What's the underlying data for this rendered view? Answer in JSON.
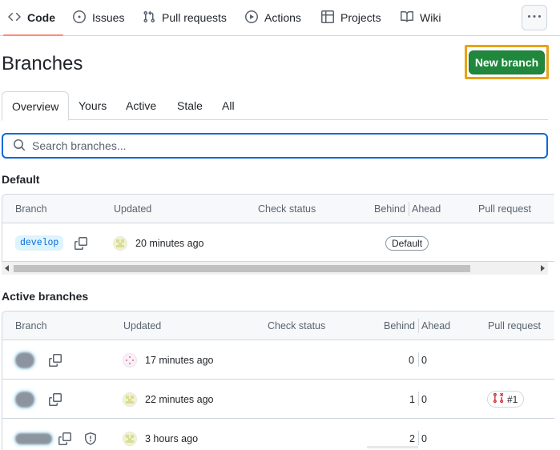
{
  "nav": {
    "tabs": [
      {
        "label": "Code",
        "icon": "code-icon",
        "active": true
      },
      {
        "label": "Issues",
        "icon": "issue-opened-icon"
      },
      {
        "label": "Pull requests",
        "icon": "git-pull-request-icon"
      },
      {
        "label": "Actions",
        "icon": "play-icon"
      },
      {
        "label": "Projects",
        "icon": "table-icon"
      },
      {
        "label": "Wiki",
        "icon": "book-icon"
      }
    ],
    "more_icon": "kebab-horizontal-icon"
  },
  "page": {
    "title": "Branches",
    "new_branch_label": "New branch"
  },
  "subtabs": [
    "Overview",
    "Yours",
    "Active",
    "Stale",
    "All"
  ],
  "search": {
    "placeholder": "Search branches..."
  },
  "default_section": {
    "title": "Default",
    "headers": [
      "Branch",
      "Updated",
      "Check status",
      "Behind",
      "Ahead",
      "Pull request"
    ],
    "rows": [
      {
        "branch": "develop",
        "updated": "20 minutes ago",
        "badge": "Default"
      }
    ]
  },
  "active_section": {
    "title": "Active branches",
    "headers": [
      "Branch",
      "Updated",
      "Check status",
      "Behind",
      "Ahead",
      "Pull request"
    ],
    "rows": [
      {
        "updated": "17 minutes ago",
        "behind": "0",
        "ahead": "0",
        "pr": ""
      },
      {
        "updated": "22 minutes ago",
        "behind": "1",
        "ahead": "0",
        "pr": "#1"
      },
      {
        "updated": "3 hours ago",
        "behind": "2",
        "ahead": "0",
        "pr": ""
      }
    ]
  },
  "colors": {
    "accent": "#0969da",
    "primary_button": "#1f883d",
    "highlight_border": "#e8a317",
    "active_tab_underline": "#fd8c73"
  }
}
